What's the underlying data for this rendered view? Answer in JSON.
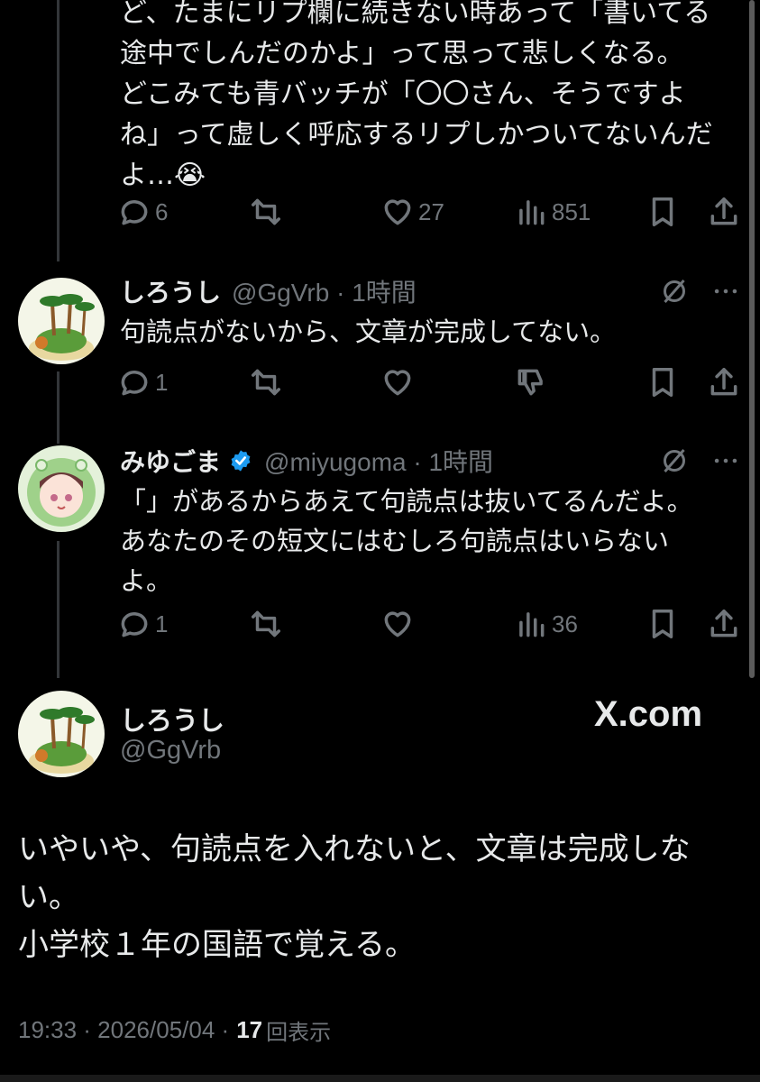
{
  "top_tweet": {
    "body": "ど、たまにリプ欄に続きない時あって「書いてる途中でしんだのかよ」って思って悲しくなる。\nどこみても青バッチが「〇〇さん、そうですよね」って虚しく呼応するリプしかついてないんだよ…😭",
    "replies": "6",
    "likes": "27",
    "views": "851"
  },
  "reply1": {
    "name": "しろうし",
    "handle_time": "@GgVrb · 1時間",
    "body": "句読点がないから、文章が完成してない。",
    "replies": "1"
  },
  "reply2": {
    "name": "みゆごま",
    "handle_time": "@miyugoma · 1時間",
    "body": "「」があるからあえて句読点は抜いてるんだよ。\nあなたのその短文にはむしろ句読点はいらないよ。",
    "replies": "1",
    "views": "36"
  },
  "main_tweet": {
    "name": "しろうし",
    "handle": "@GgVrb",
    "brand": "X.com",
    "body": "いやいや、句読点を入れないと、文章は完成しない。\n小学校１年の国語で覚える。",
    "time": "19:33 · 2026/05/04 ·",
    "views_count": "17",
    "views_label": "回表示"
  },
  "colors": {
    "background": "#000000",
    "text": "#e7e9ea",
    "muted": "#71767b",
    "verified": "#1d9bf0"
  }
}
